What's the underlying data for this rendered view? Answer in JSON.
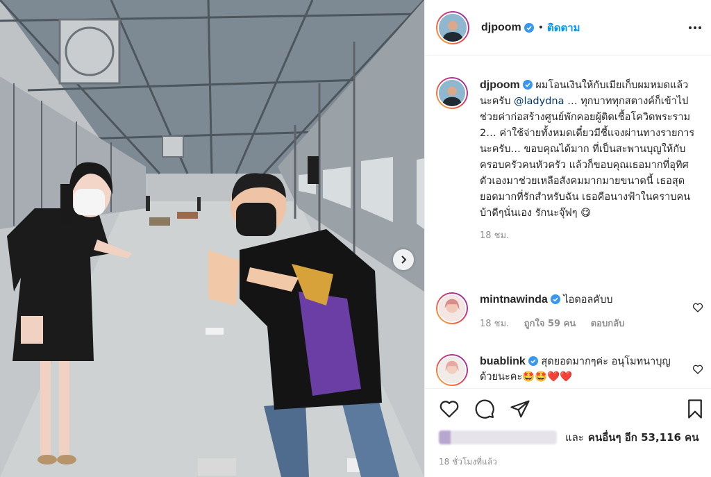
{
  "post": {
    "username": "djpoom",
    "follow_label": "ติดตาม",
    "separator": "•",
    "caption_text": "ผมโอนเงินให้กับเมียเก็บผมหมดแล้วนะครับ",
    "caption_mention": "@ladydna",
    "caption_rest": " … ทุกบาททุกสตางค์ก็เข้าไปช่วยค่าก่อสร้างศูนย์พักคอยผู้ติดเชื้อโควิดพระราม 2… ค่าใช้จ่ายทั้งหมดเดี๋ยวมีชี้แจงผ่านทางรายการนะครับ… ขอบคุณได้มาก ที่เป็นสะพานบุญให้กับครอบครัวคนหัวครัว แล้วก็ขอบคุณเธอมากที่อุทิศตัวเองมาช่วยเหลือสังคมมากมายขนาดนี้ เธอสุดยอดมากที่รักสำหรับฉัน เธอคือนางฟ้าในคราบคนบ้าดีๆนั่นเอง รักนะจุ๊ฟๆ 😋",
    "caption_time": "18 ชม."
  },
  "comments": [
    {
      "username": "mintnawinda",
      "text": "ไอดอลคับบ",
      "time": "18 ชม.",
      "likes": "ถูกใจ 59 คน",
      "reply": "ตอบกลับ"
    },
    {
      "username": "buablink",
      "text": "สุดยอดมากๆค่ะ อนุโมทนาบุญด้วยนะคะ🤩🤩❤️❤️"
    }
  ],
  "likes": {
    "and_label": "และ",
    "others_label": "คนอื่นๆ อีก 53,116 คน"
  },
  "posted_ago": "18 ชั่วโมงที่แล้ว",
  "icons": [
    "verified-badge-icon",
    "more-options-icon",
    "heart-icon",
    "comment-icon",
    "share-icon",
    "bookmark-icon",
    "chevron-right-icon"
  ],
  "colors": {
    "accent": "#0095f6",
    "verified": "#3897f0",
    "muted": "#8e8e8e",
    "mention": "#00376b"
  }
}
